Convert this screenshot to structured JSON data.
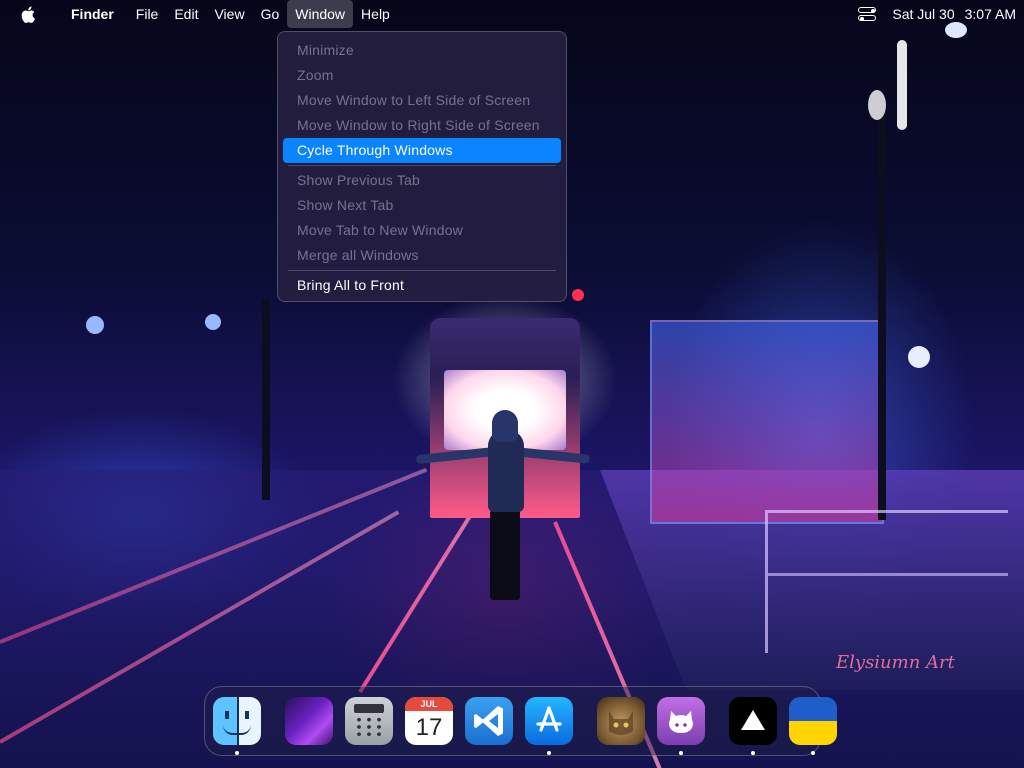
{
  "menubar": {
    "app_name": "Finder",
    "items": [
      "File",
      "Edit",
      "View",
      "Go",
      "Window",
      "Help"
    ],
    "active_item": "Window",
    "date": "Sat Jul 30",
    "time": "3:07 AM"
  },
  "window_menu": {
    "items": [
      {
        "label": "Minimize",
        "enabled": false
      },
      {
        "label": "Zoom",
        "enabled": false
      },
      {
        "label": "Move Window to Left Side of Screen",
        "enabled": false
      },
      {
        "label": "Move Window to Right Side of Screen",
        "enabled": false
      },
      {
        "label": "Cycle Through Windows",
        "enabled": true,
        "selected": true
      },
      {
        "label": "Show Previous Tab",
        "enabled": false
      },
      {
        "label": "Show Next Tab",
        "enabled": false
      },
      {
        "label": "Move Tab to New Window",
        "enabled": false
      },
      {
        "label": "Merge all Windows",
        "enabled": false
      },
      {
        "label": "Bring All to Front",
        "enabled": true
      }
    ],
    "highlight_color": "#0a84ff"
  },
  "dock": {
    "apps": [
      {
        "name": "Finder",
        "icon": "finder-icon",
        "running": true
      },
      {
        "name": "macOS Monterey",
        "icon": "monterey-icon",
        "running": false
      },
      {
        "name": "Calculator",
        "icon": "calculator-icon",
        "running": false
      },
      {
        "name": "Calendar",
        "icon": "calendar-icon",
        "running": false,
        "month": "JUL",
        "day": "17"
      },
      {
        "name": "Visual Studio Code",
        "icon": "vscode-icon",
        "running": false
      },
      {
        "name": "App Store",
        "icon": "app-store-icon",
        "running": true
      },
      {
        "name": "Cat Photo",
        "icon": "cat-photo-icon",
        "running": false
      },
      {
        "name": "GitHub Desktop",
        "icon": "github-icon",
        "running": true
      },
      {
        "name": "Vercel",
        "icon": "vercel-icon",
        "running": true
      },
      {
        "name": "Ukraine Flag",
        "icon": "ukraine-flag-icon",
        "running": true
      }
    ]
  },
  "wallpaper": {
    "watermark": "Elysiumn Art"
  }
}
